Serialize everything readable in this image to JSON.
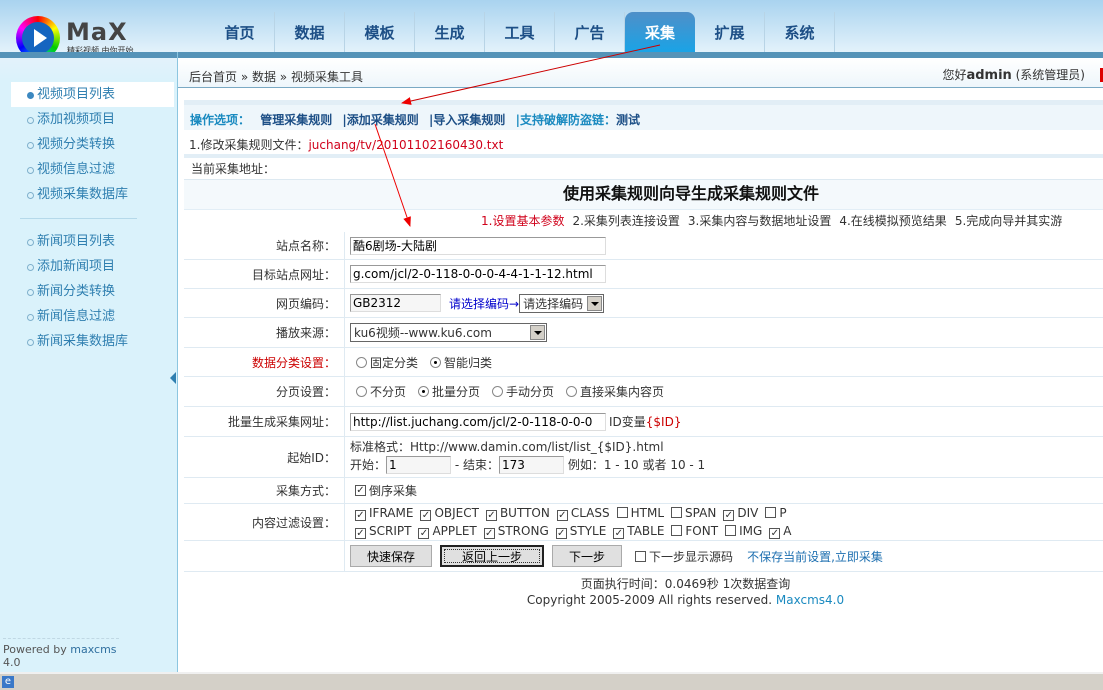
{
  "logo": {
    "text": "MaX",
    "tagline": "精彩视频 由你开始"
  },
  "nav": [
    "首页",
    "数据",
    "模板",
    "生成",
    "工具",
    "广告",
    "采集",
    "扩展",
    "系统"
  ],
  "nav_active": 6,
  "breadcrumb": "后台首页 » 数据 » 视频采集工具",
  "welcome": {
    "prefix": "您好",
    "user": "admin",
    "role": "(系统管理员)"
  },
  "sidebar": {
    "group1": [
      "视频项目列表",
      "添加视频项目",
      "视频分类转换",
      "视频信息过滤",
      "视频采集数据库"
    ],
    "group2": [
      "新闻项目列表",
      "添加新闻项目",
      "新闻分类转换",
      "新闻信息过滤",
      "新闻采集数据库"
    ],
    "active": "视频项目列表"
  },
  "powered": {
    "prefix": "Powered by",
    "link": "maxcms",
    "version": "4.0"
  },
  "ops": {
    "label": "操作选项：",
    "links": [
      "管理采集规则",
      "|添加采集规则",
      "|导入采集规则",
      "|支持破解防盗链："
    ],
    "test": "测试"
  },
  "rule_file": {
    "label": "1.修改采集规则文件：",
    "file": "juchang/tv/20101102160430.txt"
  },
  "current_url_label": "当前采集地址：",
  "wizard_title": "使用采集规则向导生成采集规则文件",
  "steps": [
    "1.设置基本参数",
    "2.采集列表连接设置",
    "3.采集内容与数据地址设置",
    "4.在线模拟预览结果",
    "5.完成向导并其实游"
  ],
  "form": {
    "site_name": {
      "label": "站点名称：",
      "value": "酷6剧场-大陆剧"
    },
    "target_url": {
      "label": "目标站点网址：",
      "value": "g.com/jcl/2-0-118-0-0-0-4-4-1-1-12.html"
    },
    "encoding": {
      "label": "网页编码：",
      "value": "GB2312",
      "hint": "请选择编码→",
      "select": "请选择编码"
    },
    "source": {
      "label": "播放来源：",
      "select": "ku6视频--www.ku6.com"
    },
    "category": {
      "label": "数据分类设置：",
      "options": [
        "固定分类",
        "智能归类"
      ],
      "selected": 1
    },
    "paging": {
      "label": "分页设置：",
      "options": [
        "不分页",
        "批量分页",
        "手动分页",
        "直接采集内容页"
      ],
      "selected": 1
    },
    "batch_url": {
      "label": "批量生成采集网址：",
      "value": "http://list.juchang.com/jcl/2-0-118-0-0-0",
      "id_var_label": "ID变量",
      "id_var": "{$ID}"
    },
    "start_id": {
      "label": "起始ID：",
      "format": "标准格式：Http://www.damin.com/list/list_{$ID}.html",
      "start_label": "开始：",
      "start": "1",
      "end_label": "- 结束：",
      "end": "173",
      "example": "例如：1 - 10 或者  10 - 1"
    },
    "method": {
      "label": "采集方式：",
      "option": "倒序采集",
      "checked": true
    },
    "filter": {
      "label": "内容过滤设置：",
      "items": [
        {
          "name": "IFRAME",
          "checked": true
        },
        {
          "name": "OBJECT",
          "checked": true
        },
        {
          "name": "BUTTON",
          "checked": true
        },
        {
          "name": "CLASS",
          "checked": true
        },
        {
          "name": "HTML",
          "checked": false
        },
        {
          "name": "SPAN",
          "checked": false
        },
        {
          "name": "DIV",
          "checked": true
        },
        {
          "name": "P",
          "checked": false
        },
        {
          "name": "SCRIPT",
          "checked": true
        },
        {
          "name": "APPLET",
          "checked": true
        },
        {
          "name": "STRONG",
          "checked": true
        },
        {
          "name": "STYLE",
          "checked": true
        },
        {
          "name": "TABLE",
          "checked": true
        },
        {
          "name": "FONT",
          "checked": false
        },
        {
          "name": "IMG",
          "checked": false
        },
        {
          "name": "A",
          "checked": true
        }
      ]
    }
  },
  "buttons": {
    "quick_save": "快速保存",
    "back": "返回上一步",
    "next": "下一步",
    "show_source": "下一步显示源码",
    "collect_now": "不保存当前设置,立即采集"
  },
  "footer": {
    "exec": "页面执行时间：0.0469秒 1次数据查询",
    "copyright": "Copyright 2005-2009 All rights reserved.",
    "brand": "Maxcms4.0"
  }
}
